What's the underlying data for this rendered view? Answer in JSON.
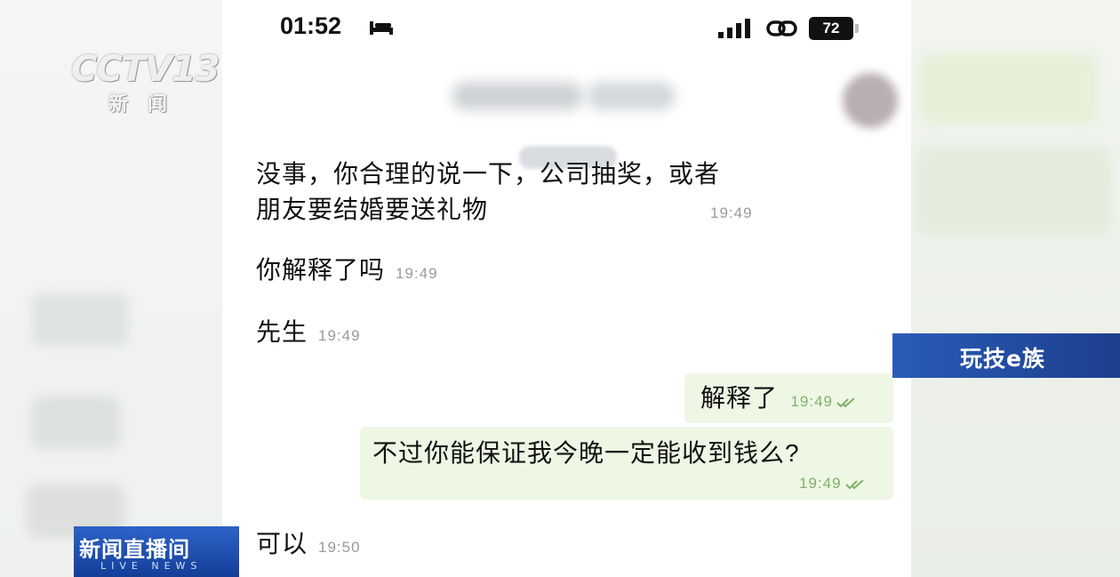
{
  "status_bar": {
    "time": "01:52",
    "battery": "72",
    "icons": [
      "bed-icon",
      "signal-icon",
      "link-icon",
      "battery-icon"
    ]
  },
  "chat": {
    "messages": [
      {
        "direction": "in",
        "lines": [
          "没事，你合理的说一下，公司抽奖，或者",
          "朋友要结婚要送礼物"
        ],
        "time": "19:49"
      },
      {
        "direction": "in",
        "text": "你解释了吗",
        "time": "19:49"
      },
      {
        "direction": "in",
        "text": "先生",
        "time": "19:49"
      },
      {
        "direction": "out",
        "text": "解释了",
        "time": "19:49",
        "status_icon": "double-check-icon"
      },
      {
        "direction": "out",
        "text": "不过你能保证我今晚一定能收到钱么?",
        "time": "19:49",
        "status_icon": "double-check-icon"
      },
      {
        "direction": "in",
        "text": "可以",
        "time": "19:50"
      }
    ]
  },
  "overlay": {
    "logo": {
      "main": "CCTV13",
      "sub": "新闻"
    },
    "live_badge": {
      "title": "新闻直播间",
      "subtitle": "LIVE NEWS"
    },
    "program_badge": {
      "title": "玩技e族"
    }
  },
  "colors": {
    "outgoing_bubble": "#eef7e4",
    "badge_blue": "#1c3f8c",
    "read_check": "#7fb06a"
  }
}
